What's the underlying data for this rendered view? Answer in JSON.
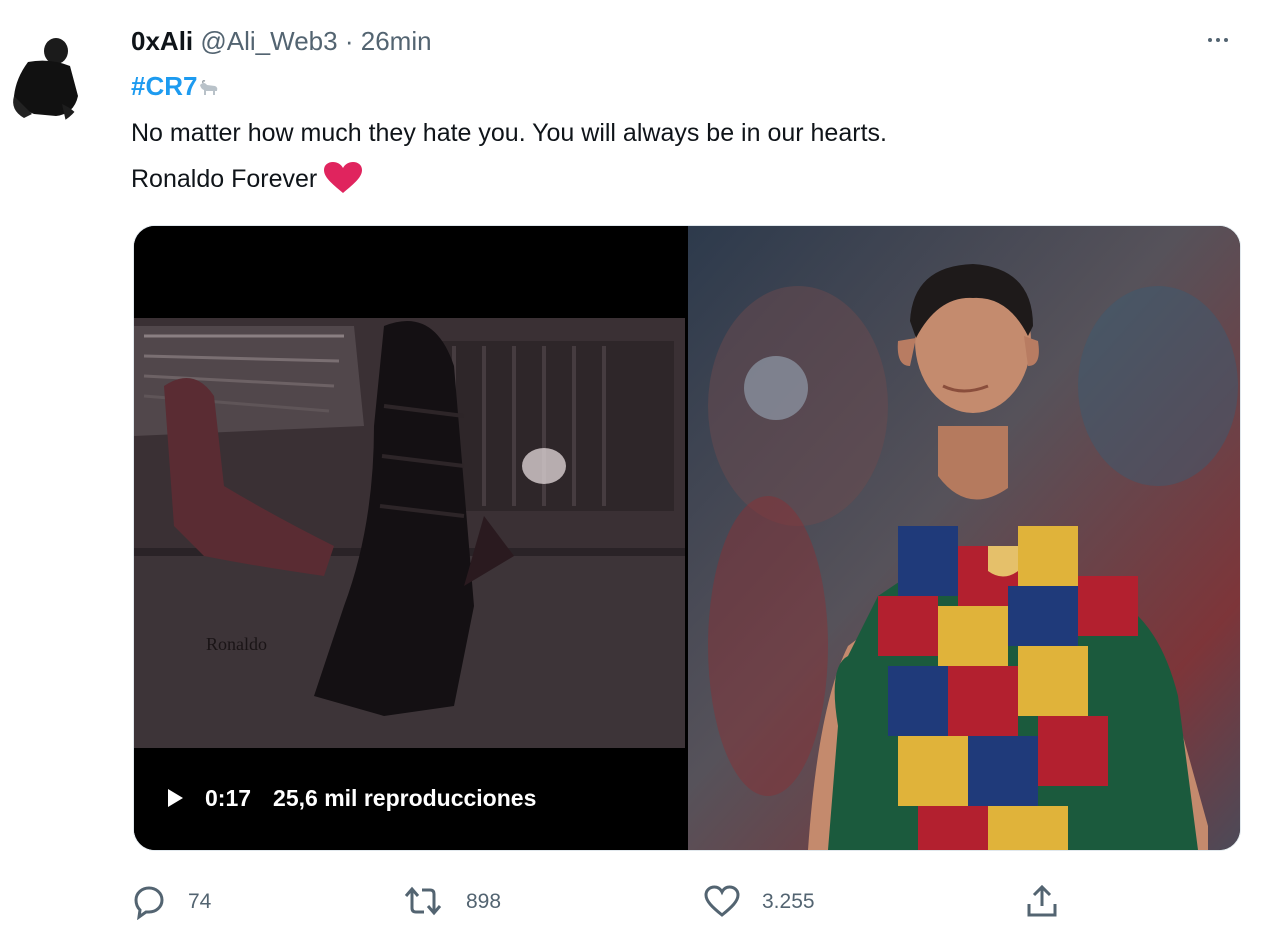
{
  "tweet": {
    "display_name": "0xAli",
    "handle": "@Ali_Web3",
    "separator": "·",
    "time": "26min",
    "hashtag": "#CR7",
    "text_line1": "No matter how much they hate you. You will always be in our hearts.",
    "text_line2": "Ronaldo Forever",
    "heart_emoji": "red-heart-emoji",
    "hashtag_emoji": "goat-emoji"
  },
  "media": {
    "video": {
      "duration": "0:17",
      "views": "25,6 mil reproducciones",
      "watermark": "Ronaldo"
    },
    "photo": {}
  },
  "actions": {
    "reply_count": "74",
    "retweet_count": "898",
    "like_count": "3.255",
    "share_icon": "share-icon"
  },
  "colors": {
    "link": "#1d9bf0",
    "secondary_text": "#536471",
    "heart": "#e0245e"
  }
}
